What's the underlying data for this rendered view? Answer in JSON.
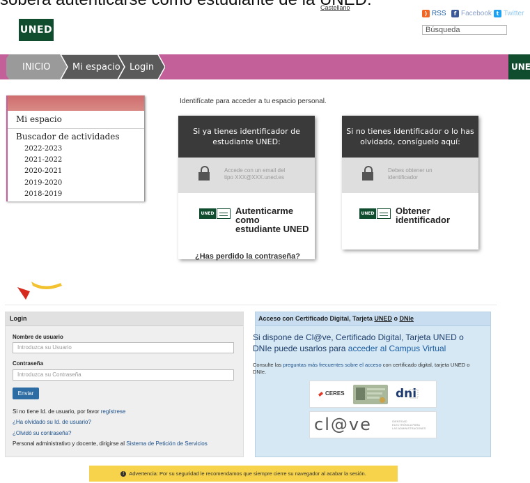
{
  "page": {
    "cropped_heading": "sobera autenticarse como estudiante de la UNED."
  },
  "header": {
    "logo_text": "UNED",
    "language_link": "Castellano",
    "social": [
      {
        "label": "RSS",
        "icon": "rss-icon",
        "color": "#f26522"
      },
      {
        "label": "Facebook",
        "icon": "facebook-icon",
        "color": "#3b5998"
      },
      {
        "label": "Twitter",
        "icon": "twitter-icon",
        "color": "#1da1f2"
      }
    ],
    "search_placeholder": "Búsqueda",
    "right_logo_text": "UNE"
  },
  "breadcrumb": {
    "items": [
      "INICIO",
      "Mi espacio",
      "Login"
    ],
    "bar_color": "#c3609a"
  },
  "sidebar": {
    "title": "Mi espacio",
    "subtitle": "Buscador de actividades",
    "years": [
      "2022-2023",
      "2021-2022",
      "2020-2021",
      "2019-2020",
      "2018-2019"
    ]
  },
  "main": {
    "intro": "Identifícate para acceder a tu espacio personal.",
    "card_student": {
      "header": "Si ya tienes identificador de estudiante UNED:",
      "note_line1": "Accede con un email del",
      "note_line2": "tipo XXX@XXX.uned.es",
      "action_line1": "Autenticarme como",
      "action_line2": "estudiante UNED",
      "lost_password": "¿Has perdido la contraseña?"
    },
    "card_new": {
      "header": "Si no tienes identificador o lo has olvidado, consíguelo aquí:",
      "note_line1": "Debes obtener un",
      "note_line2": "identificador",
      "action_line1": "Obtener",
      "action_line2": "identificador"
    },
    "mini_logo": "UNED"
  },
  "login_panel": {
    "title": "Login",
    "username_label": "Nombre de usuario",
    "username_placeholder": "Introduzca su Usuario",
    "password_label": "Contraseña",
    "password_placeholder": "Introduzca su Contraseña",
    "submit": "Enviar",
    "register_prefix": "Si no tiene Id. de usuario, por favor",
    "register_link": "regístrese",
    "forgot_user": "¿Ha olvidado su Id. de usuario?",
    "forgot_password": "¿Olvidó su contraseña?",
    "staff_prefix": "Personal administrativo y docente, dirigirse al",
    "staff_link": "Sistema de Petición de Servicios"
  },
  "cert_panel": {
    "title_prefix": "Acceso con Certificado Digital, Tarjeta",
    "title_uned": "UNED",
    "title_mid": "o",
    "title_dni": "DNIe",
    "big_text": "Si dispone de Cl@ve, Certificado Digital, Tarjeta UNED o DNIe puede usarlos para",
    "big_link": "acceder al Campus Virtual",
    "small_prefix": "Consulte las",
    "small_link": "preguntas más frecuentes sobre el acceso",
    "small_suffix": "con certificado digital, tarjeta UNED o DNIe.",
    "ceres_label": "CERES",
    "dni_label": "dni",
    "clave_label": "cl@ve",
    "clave_sub1": "IDENTIDAD",
    "clave_sub2": "ELECTRÓNICA PARA",
    "clave_sub3": "LAS ADMINISTRACIONES"
  },
  "warning": {
    "text": "Advertencia: Por su seguridad le recomendamos que siempre cierre su navegador al acabar la sesión."
  }
}
